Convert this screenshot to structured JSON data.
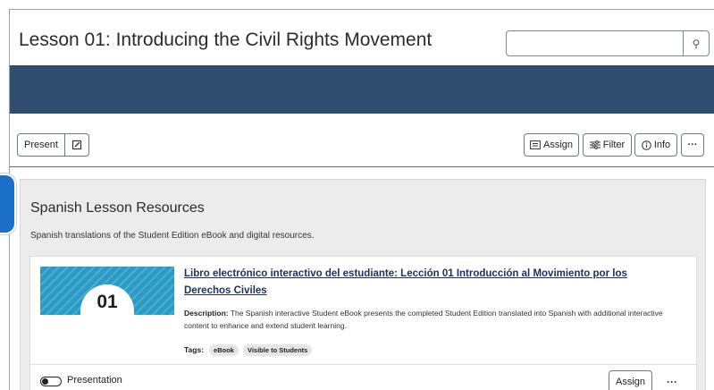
{
  "page": {
    "title": "Lesson 01: Introducing the Civil Rights Movement"
  },
  "search": {
    "placeholder": "",
    "button_icon": "search-icon",
    "button_glyph": "⚲"
  },
  "toolbar": {
    "present_label": "Present",
    "edit_icon": "edit-icon",
    "assign_label": "Assign",
    "filter_label": "Filter",
    "info_label": "Info",
    "more_glyph": "···"
  },
  "section": {
    "title": "Spanish Lesson Resources",
    "description": "Spanish translations of the Student Edition eBook and digital resources."
  },
  "resource": {
    "thumbnail_number": "01",
    "title": "Libro electrónico interactivo del estudiante: Lección 01 Introducción al Movimiento por los Derechos Civiles",
    "description_label": "Description:",
    "description_text": " The Spanish interactive Student eBook presents the completed Student Edition translated into Spanish with additional interactive content to enhance and extend student learning.",
    "tags_label": "Tags:",
    "tags": [
      "eBook",
      "Visible to Students"
    ],
    "presentation_label": "Presentation",
    "presentation_toggle_on": false,
    "assign_label": "Assign",
    "more_glyph": "···"
  },
  "colors": {
    "banner": "#2f4d6e",
    "link": "#1c2f5e",
    "thumbnail": "#2a9bc4",
    "pointer": "#1c6fc6"
  }
}
